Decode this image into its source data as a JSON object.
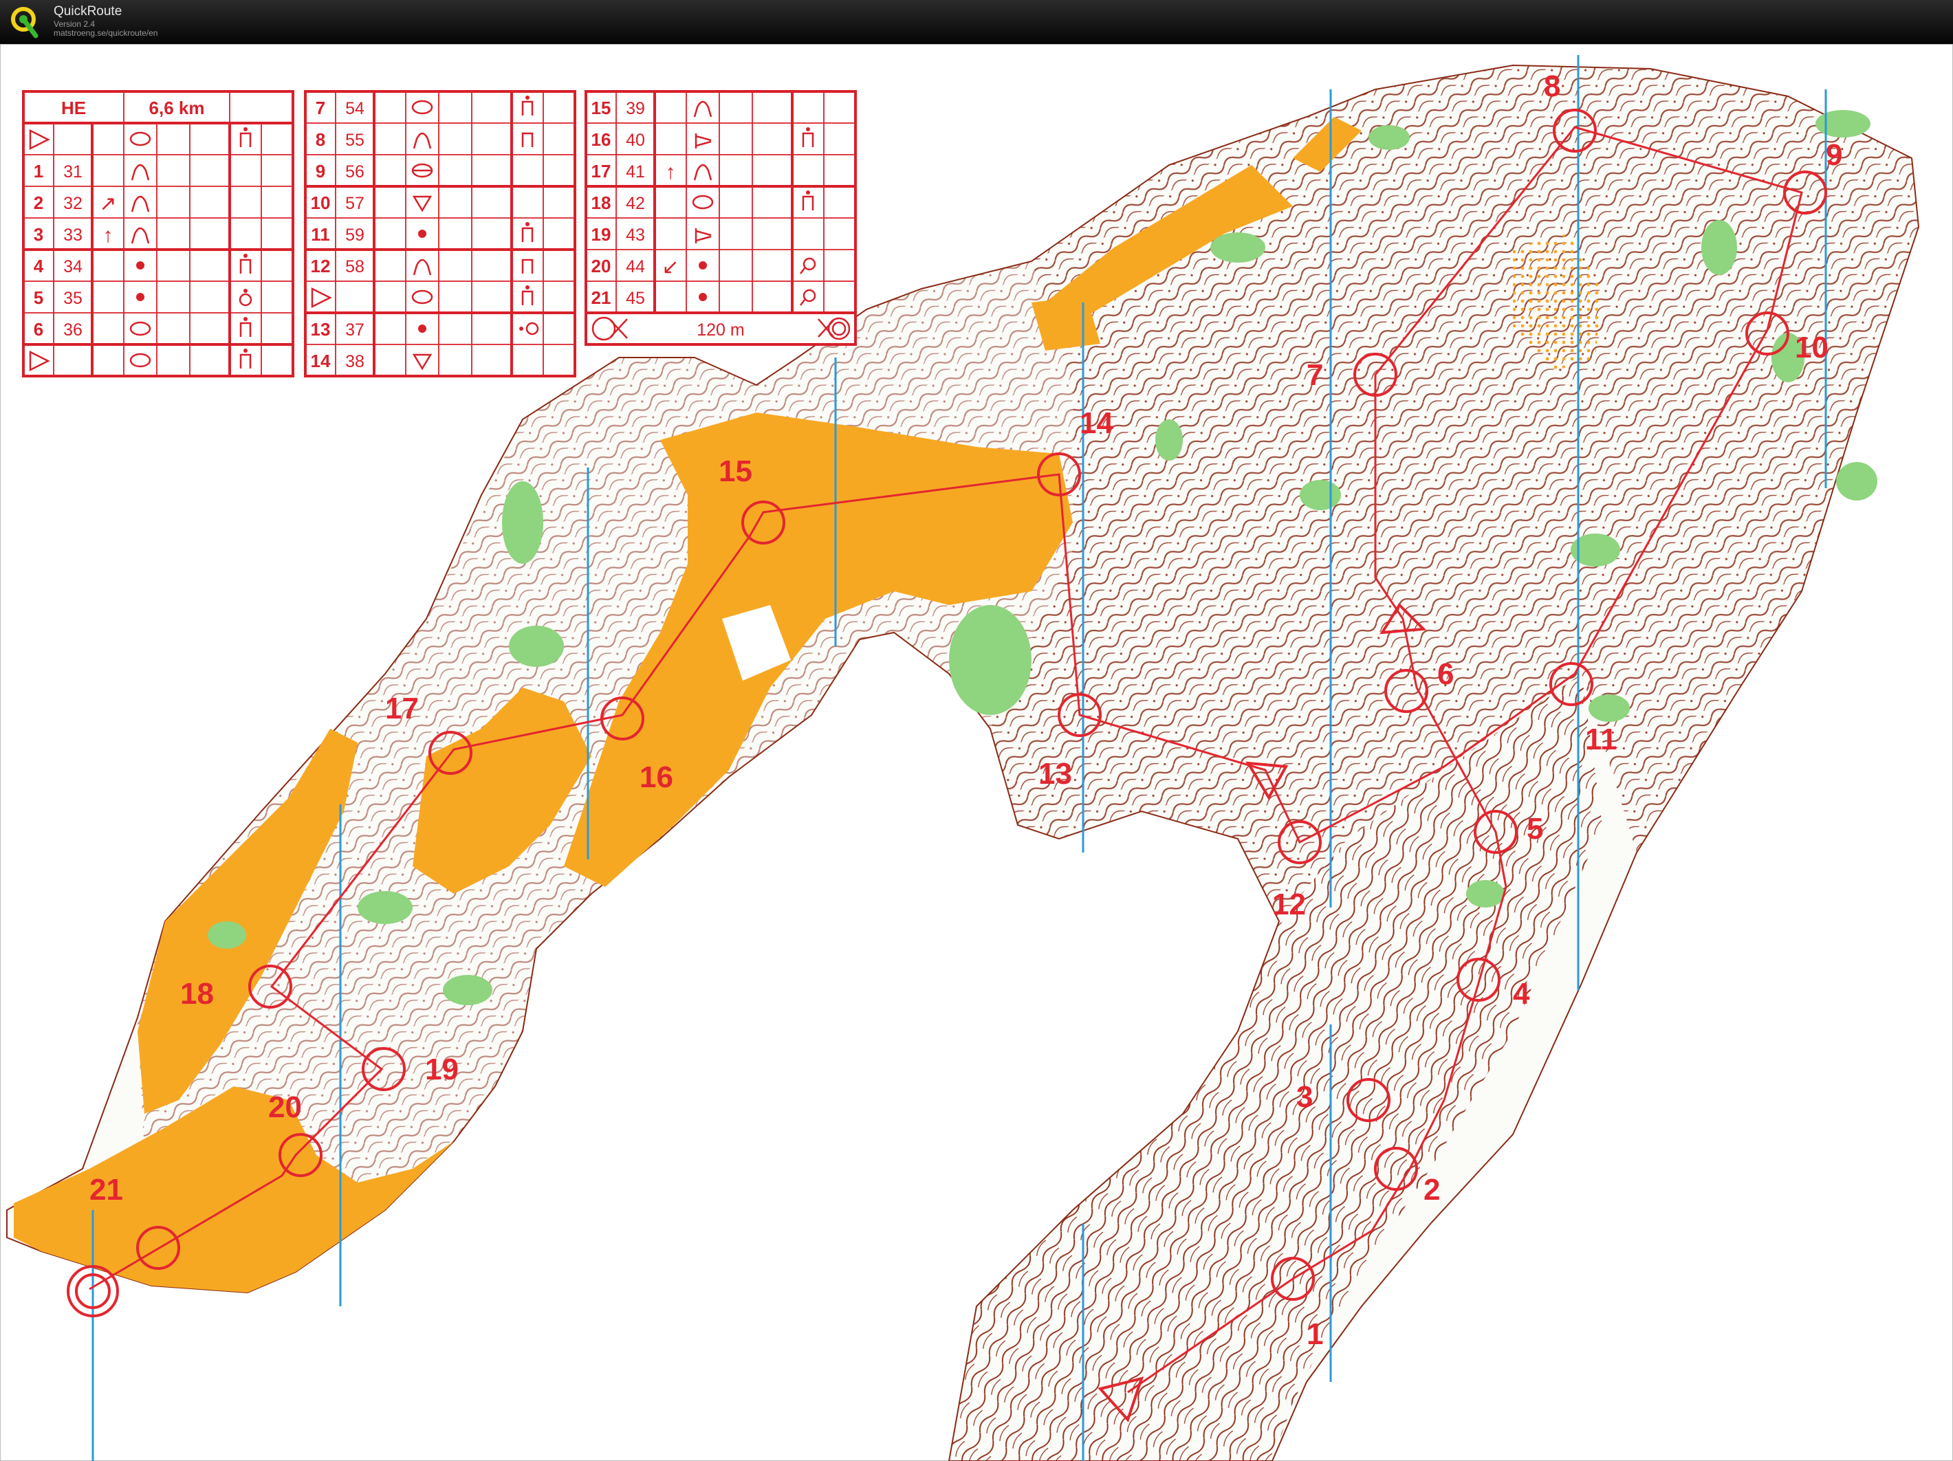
{
  "app": {
    "title": "QuickRoute",
    "version": "Version 2.4",
    "url": "matstroeng.se/quickroute/en",
    "icon": "quickroute-logo-icon"
  },
  "colors": {
    "course": "#e3262f",
    "contour": "#8a2a14",
    "open_land": "#f7a823",
    "green": "#8fd47f",
    "north_line": "#2b9ad8"
  },
  "description_sheet": {
    "header": {
      "course": "HE",
      "length": "6,6 km"
    },
    "start_symbol": "start-triangle-icon",
    "rows_table1": [
      {
        "n": "",
        "code": "",
        "dir": "",
        "feature": "oval",
        "detail": "",
        "extra": "",
        "start": true,
        "extra2": "water-point"
      },
      {
        "n": "1",
        "code": "31",
        "dir": "",
        "feature": "knoll"
      },
      {
        "n": "2",
        "code": "32",
        "dir": "↗",
        "feature": "knoll"
      },
      {
        "n": "3",
        "code": "33",
        "dir": "↑",
        "feature": "knoll"
      },
      {
        "n": "4",
        "code": "34",
        "dir": "",
        "feature": "dot",
        "extra2": "water-point"
      },
      {
        "n": "5",
        "code": "35",
        "dir": "",
        "feature": "dot",
        "extra2": "refresh"
      },
      {
        "n": "6",
        "code": "36",
        "dir": "",
        "feature": "oval",
        "extra2": "water-point"
      },
      {
        "n": "",
        "code": "",
        "dir": "",
        "feature": "oval",
        "start": true,
        "extra2": "water-point"
      }
    ],
    "rows_table2": [
      {
        "n": "7",
        "code": "54",
        "feature": "oval",
        "extra2": "water-point"
      },
      {
        "n": "8",
        "code": "55",
        "feature": "knoll",
        "extra2": "control-point"
      },
      {
        "n": "9",
        "code": "56",
        "feature": "depression"
      },
      {
        "n": "10",
        "code": "57",
        "feature": "pit"
      },
      {
        "n": "11",
        "code": "59",
        "feature": "dot",
        "extra2": "water-point"
      },
      {
        "n": "12",
        "code": "58",
        "feature": "knoll",
        "extra2": "control-point"
      },
      {
        "n": "",
        "code": "",
        "feature": "oval",
        "start": true,
        "extra2": "water-point"
      },
      {
        "n": "13",
        "code": "37",
        "feature": "dot",
        "extra2": "marked-route"
      },
      {
        "n": "14",
        "code": "38",
        "feature": "pit"
      }
    ],
    "rows_table3": [
      {
        "n": "15",
        "code": "39",
        "dir": "",
        "feature": "knoll"
      },
      {
        "n": "16",
        "code": "40",
        "dir": "",
        "feature": "spur",
        "extra2": "water-point"
      },
      {
        "n": "17",
        "code": "41",
        "dir": "↑",
        "feature": "knoll"
      },
      {
        "n": "18",
        "code": "42",
        "dir": "",
        "feature": "oval",
        "extra2": "water-point"
      },
      {
        "n": "19",
        "code": "43",
        "dir": "",
        "feature": "spur"
      },
      {
        "n": "20",
        "code": "44",
        "dir": "↙",
        "feature": "dot",
        "extra2": "magnifier"
      },
      {
        "n": "21",
        "code": "45",
        "dir": "",
        "feature": "dot",
        "extra2": "magnifier"
      }
    ],
    "finish": {
      "distance": "120 m"
    }
  },
  "controls": [
    {
      "label": "1"
    },
    {
      "label": "2"
    },
    {
      "label": "3"
    },
    {
      "label": "4"
    },
    {
      "label": "5"
    },
    {
      "label": "6"
    },
    {
      "label": "7"
    },
    {
      "label": "8"
    },
    {
      "label": "9"
    },
    {
      "label": "10"
    },
    {
      "label": "11"
    },
    {
      "label": "12"
    },
    {
      "label": "13"
    },
    {
      "label": "14"
    },
    {
      "label": "15"
    },
    {
      "label": "16"
    },
    {
      "label": "17"
    },
    {
      "label": "18"
    },
    {
      "label": "19"
    },
    {
      "label": "20"
    },
    {
      "label": "21"
    }
  ]
}
